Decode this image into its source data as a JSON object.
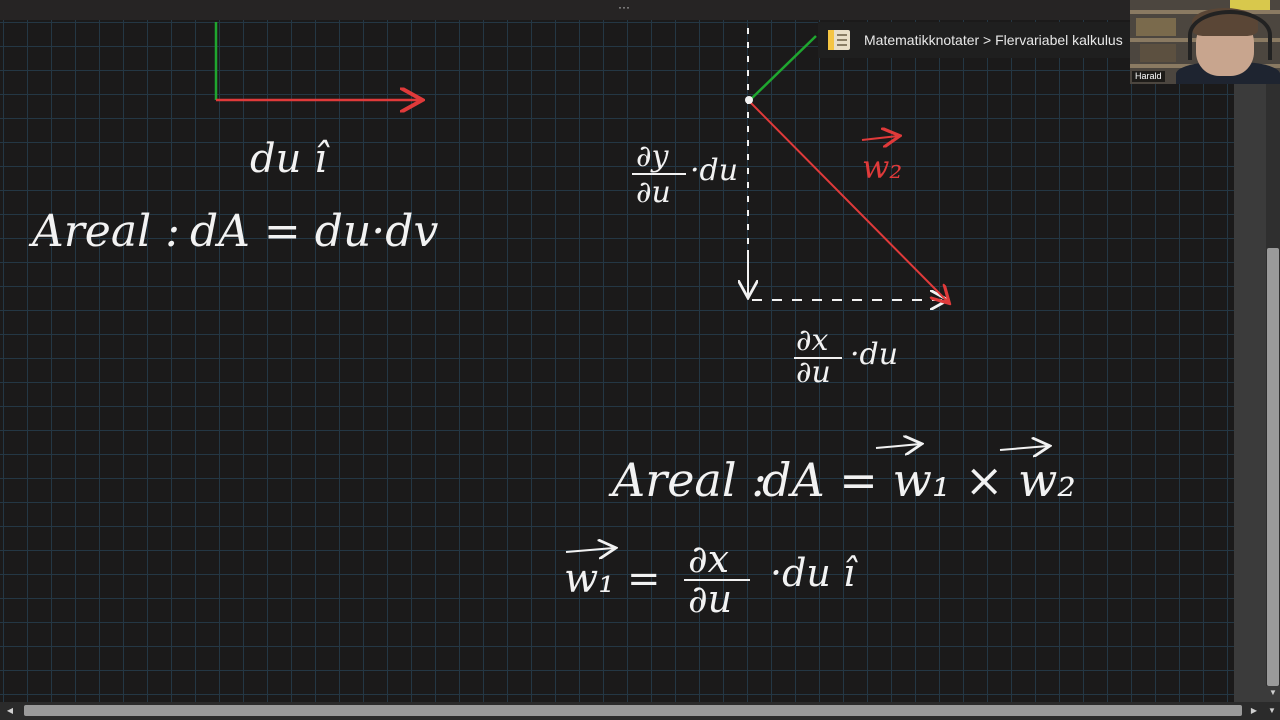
{
  "toolbar": {
    "more_dots": "···"
  },
  "notebook": {
    "breadcrumb": "Matematikknotater > Flervariabel kalkulus",
    "icon": "notebook-icon"
  },
  "webcam": {
    "participant_name": "Harald"
  },
  "scrollbars": {
    "up_arrow": "▲",
    "down_arrow": "▼",
    "left_arrow": "◀",
    "right_arrow": "▶"
  },
  "colors": {
    "ink_white": "#f2f2f2",
    "ink_red": "#e03a3a",
    "ink_green": "#1fa62f",
    "grid": "#243744",
    "canvas_bg": "#1b1a1a"
  },
  "handwriting": {
    "left_vector_label": "du î",
    "left_area_label": "Areal :",
    "left_area_formula": "dA = du·dv",
    "dy_du_num": "∂y",
    "dy_du_den": "∂u",
    "dy_du_tail": "·du",
    "w2_label": "w₂",
    "dx_du_num": "∂x",
    "dx_du_den": "∂u",
    "dx_du_tail": "·du",
    "right_area_label": "Areal :",
    "right_area_formula": "dA = w₁ × w₂",
    "w1_lhs": "w₁ =",
    "w1_num": "∂x",
    "w1_den": "∂u",
    "w1_tail": "·du î"
  }
}
